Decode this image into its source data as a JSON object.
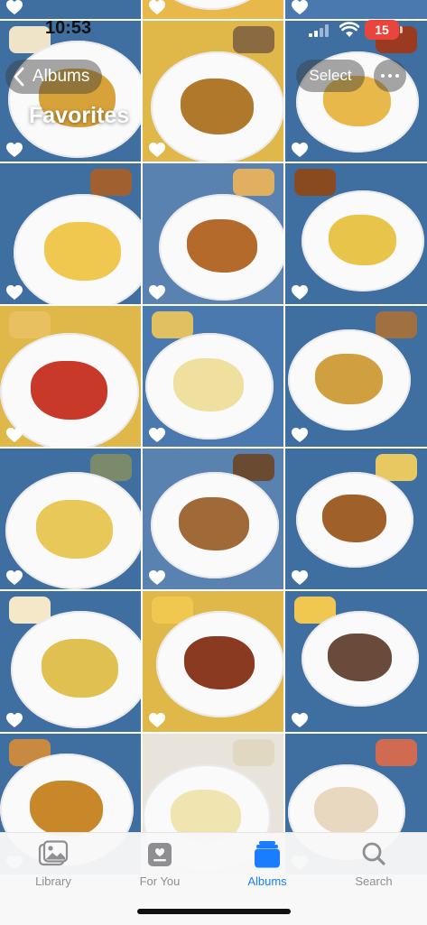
{
  "status_bar": {
    "time": "10:53",
    "battery": "15",
    "battery_color": "#e8453c"
  },
  "nav": {
    "back_label": "Albums",
    "title": "Favorites",
    "select_label": "Select"
  },
  "tabs": [
    {
      "label": "Library",
      "icon": "photo-library-icon",
      "active": false
    },
    {
      "label": "For You",
      "icon": "for-you-icon",
      "active": false
    },
    {
      "label": "Albums",
      "icon": "albums-icon",
      "active": true
    },
    {
      "label": "Search",
      "icon": "search-icon",
      "active": false
    }
  ],
  "grid": {
    "favorited": true,
    "photos": [
      {
        "tray": "#3f6fa0",
        "food": "#d8a23a",
        "side": "#c9a36a"
      },
      {
        "tray": "#e8b84a",
        "food": "#8a5a2a",
        "side": "#c9a36a"
      },
      {
        "tray": "#4a79b0",
        "food": "#c25a24",
        "side": "#d0a050"
      },
      {
        "tray": "#3f6fa0",
        "food": "#d8a23a",
        "side": "#f0e4c8"
      },
      {
        "tray": "#e0b84a",
        "food": "#b0782a",
        "side": "#8a6a40"
      },
      {
        "tray": "#3f6fa0",
        "food": "#e8b84a",
        "side": "#9a3a20"
      },
      {
        "tray": "#3f6fa0",
        "food": "#f0c850",
        "side": "#a06030"
      },
      {
        "tray": "#5a82b0",
        "food": "#b46a2a",
        "side": "#e0b060"
      },
      {
        "tray": "#3f6fa0",
        "food": "#e8c44a",
        "side": "#8a4a20"
      },
      {
        "tray": "#e0b84a",
        "food": "#c8392a",
        "side": "#e8c060"
      },
      {
        "tray": "#4a79b0",
        "food": "#f0e0a0",
        "side": "#e0c060"
      },
      {
        "tray": "#3f6fa0",
        "food": "#d0a040",
        "side": "#a07040"
      },
      {
        "tray": "#3f6fa0",
        "food": "#e8c858",
        "side": "#7a8a6a"
      },
      {
        "tray": "#5a82b0",
        "food": "#a06a38",
        "side": "#6a4a30"
      },
      {
        "tray": "#3f6fa0",
        "food": "#a0602a",
        "side": "#e8c860"
      },
      {
        "tray": "#3f6fa0",
        "food": "#e0c050",
        "side": "#f4e8c8"
      },
      {
        "tray": "#e0b84a",
        "food": "#8a3a20",
        "side": "#f0c850"
      },
      {
        "tray": "#3f6fa0",
        "food": "#6a4a3a",
        "side": "#f0c850"
      },
      {
        "tray": "#3f6fa0",
        "food": "#c8882a",
        "side": "#c88a40"
      },
      {
        "tray": "#e8e4dc",
        "food": "#f0e4b0",
        "side": "#e0d8c0"
      },
      {
        "tray": "#3f6fa0",
        "food": "#e8d8c0",
        "side": "#d06a50"
      }
    ]
  }
}
